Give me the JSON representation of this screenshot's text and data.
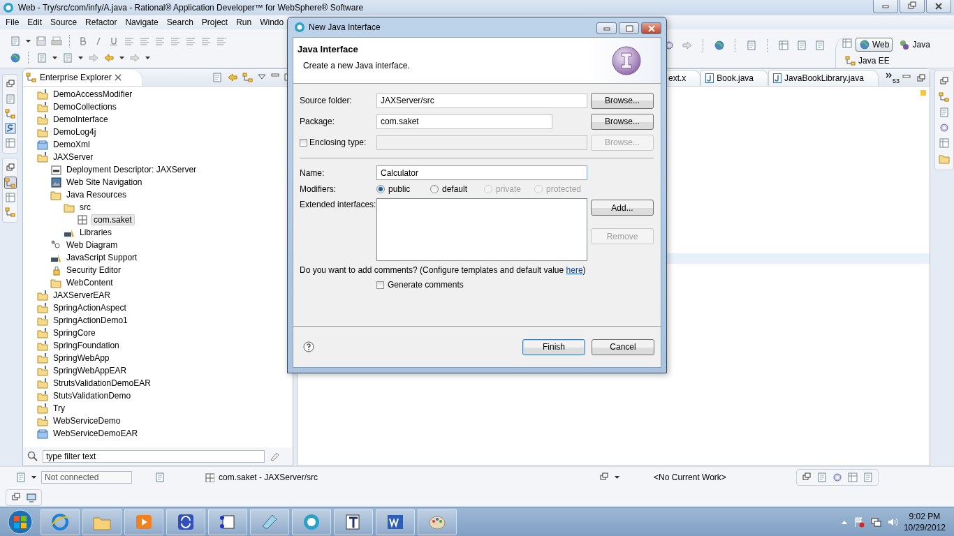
{
  "window": {
    "title": "Web - Try/src/com/infy/A.java - Rational® Application Developer™ for WebSphere® Software"
  },
  "menu": [
    "File",
    "Edit",
    "Source",
    "Refactor",
    "Navigate",
    "Search",
    "Project",
    "Run",
    "Windo"
  ],
  "perspectives": [
    {
      "label": "Web",
      "selected": true
    },
    {
      "label": "Java",
      "selected": false
    },
    {
      "label": "Java EE",
      "selected": false
    }
  ],
  "explorer": {
    "title": "Enterprise Explorer",
    "filter": {
      "placeholder": "type filter text"
    },
    "tree": [
      {
        "label": "DemoAccessModifier",
        "kind": "project",
        "selected": false
      },
      {
        "label": "DemoCollections",
        "kind": "project",
        "selected": false
      },
      {
        "label": "DemoInterface",
        "kind": "project",
        "selected": false
      },
      {
        "label": "DemoLog4j",
        "kind": "project",
        "selected": false
      },
      {
        "label": "DemoXml",
        "kind": "box",
        "selected": false
      },
      {
        "label": "JAXServer",
        "kind": "project",
        "selected": false,
        "children": [
          {
            "label": "Deployment Descriptor: JAXServer",
            "kind": "descriptor",
            "selected": false
          },
          {
            "label": "Web Site Navigation",
            "kind": "image",
            "selected": false
          },
          {
            "label": "Java Resources",
            "kind": "folder",
            "selected": false,
            "children": [
              {
                "label": "src",
                "kind": "folder",
                "selected": false,
                "children": [
                  {
                    "label": "com.saket",
                    "kind": "package",
                    "selected": true
                  }
                ]
              },
              {
                "label": "Libraries",
                "kind": "library",
                "selected": false
              }
            ]
          },
          {
            "label": "Web Diagram",
            "kind": "diagram",
            "selected": false
          },
          {
            "label": "JavaScript Support",
            "kind": "library",
            "selected": false
          },
          {
            "label": "Security Editor",
            "kind": "lock",
            "selected": false
          },
          {
            "label": "WebContent",
            "kind": "folder",
            "selected": false
          }
        ]
      },
      {
        "label": "JAXServerEAR",
        "kind": "project",
        "selected": false
      },
      {
        "label": "SpringActionAspect",
        "kind": "project",
        "selected": false
      },
      {
        "label": "SpringActionDemo1",
        "kind": "project",
        "selected": false
      },
      {
        "label": "SpringCore",
        "kind": "project",
        "selected": false
      },
      {
        "label": "SpringFoundation",
        "kind": "project",
        "selected": false
      },
      {
        "label": "SpringWebApp",
        "kind": "project",
        "selected": false
      },
      {
        "label": "SpringWebAppEAR",
        "kind": "project",
        "selected": false
      },
      {
        "label": "StrutsValidationDemoEAR",
        "kind": "project",
        "selected": false
      },
      {
        "label": "StutsValidationDemo",
        "kind": "project",
        "selected": false
      },
      {
        "label": "Try",
        "kind": "project",
        "selected": false
      },
      {
        "label": "WebServiceDemo",
        "kind": "project",
        "selected": false
      },
      {
        "label": "WebServiceDemoEAR",
        "kind": "box",
        "selected": false
      }
    ]
  },
  "editor": {
    "tabs": [
      {
        "label": "ext.x",
        "selected": false
      },
      {
        "label": "Book.java",
        "selected": false
      },
      {
        "label": "JavaBookLibrary.java",
        "selected": false
      }
    ],
    "overflow_count": "53"
  },
  "status_bar": {
    "connection": "Not connected",
    "location": "com.saket - JAXServer/src",
    "work": "<No Current Work>"
  },
  "taskbar": {
    "time": "9:02 PM",
    "date": "10/29/2012"
  },
  "dialog": {
    "title": "New Java Interface",
    "heading": "Java Interface",
    "description": "Create a new Java interface.",
    "fields": [
      {
        "kind": "text",
        "label": "Source folder:",
        "value": "JAXServer/src",
        "button": "Browse...",
        "disabled": false
      },
      {
        "kind": "text",
        "label": "Package:",
        "value": "com.saket",
        "button": "Browse...",
        "disabled": false
      },
      {
        "kind": "checkbox",
        "label": "Enclosing type:",
        "checked": false,
        "button": "Browse...",
        "disabled": true
      }
    ],
    "name": {
      "label": "Name:",
      "value": "Calculator"
    },
    "modifiers": {
      "label": "Modifiers:",
      "options": [
        {
          "label": "public",
          "selected": true,
          "disabled": false
        },
        {
          "label": "default",
          "selected": false,
          "disabled": false
        },
        {
          "label": "private",
          "selected": false,
          "disabled": true
        },
        {
          "label": "protected",
          "selected": false,
          "disabled": true
        }
      ]
    },
    "extended": {
      "label": "Extended interfaces:",
      "buttons": [
        {
          "label": "Add...",
          "disabled": false
        },
        {
          "label": "Remove",
          "disabled": true
        }
      ]
    },
    "comments": {
      "before": "Do you want to add comments? (Configure templates and default value ",
      "link": "here",
      "after": ")"
    },
    "generate": {
      "label": "Generate comments",
      "checked": false
    },
    "buttons": [
      {
        "label": "Finish",
        "default": true
      },
      {
        "label": "Cancel",
        "default": false
      }
    ]
  }
}
